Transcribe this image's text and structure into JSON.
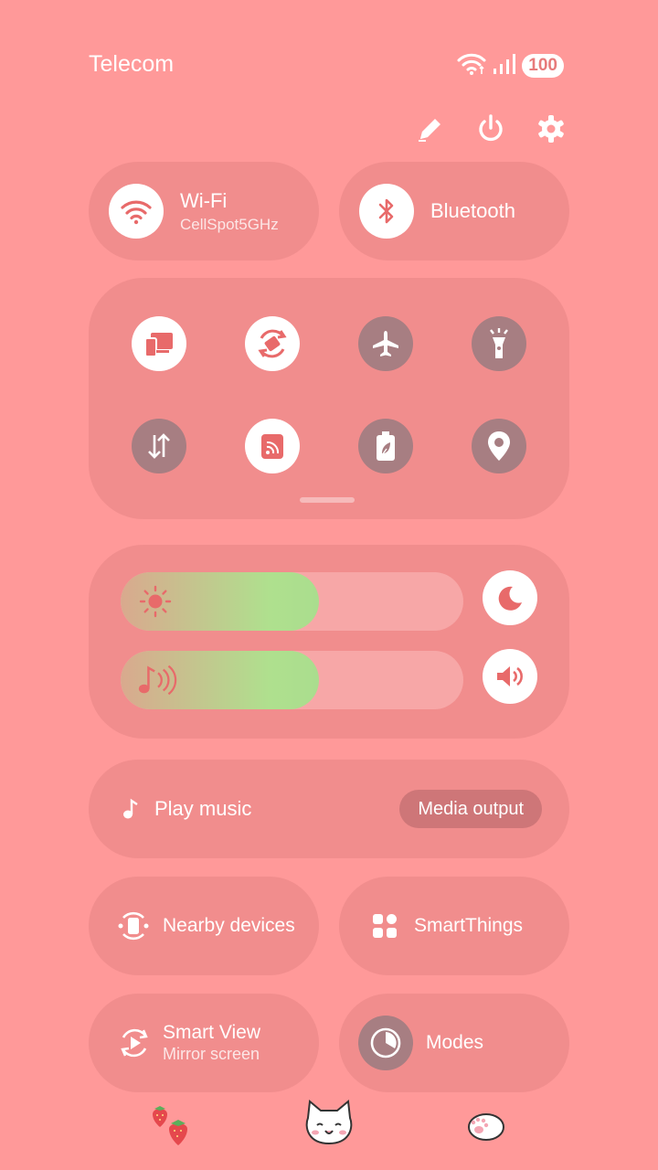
{
  "status": {
    "carrier": "Telecom",
    "battery": "100",
    "wifi_icon": "wifi-status-icon",
    "signal_icon": "signal-icon"
  },
  "toolbar": {
    "edit_icon": "pencil-icon",
    "power_icon": "power-icon",
    "settings_icon": "gear-icon"
  },
  "tiles": {
    "wifi": {
      "label": "Wi-Fi",
      "sub": "CellSpot5GHz",
      "state": "on"
    },
    "bluetooth": {
      "label": "Bluetooth",
      "state": "on"
    }
  },
  "quick_buttons": [
    {
      "icon": "device-transfer-icon",
      "state": "on"
    },
    {
      "icon": "auto-rotate-icon",
      "state": "on"
    },
    {
      "icon": "airplane-icon",
      "state": "off"
    },
    {
      "icon": "flashlight-icon",
      "state": "off"
    },
    {
      "icon": "mobile-data-icon",
      "state": "off"
    },
    {
      "icon": "cast-icon",
      "state": "on"
    },
    {
      "icon": "power-saving-icon",
      "state": "off"
    },
    {
      "icon": "location-icon",
      "state": "off"
    }
  ],
  "sliders": {
    "brightness": {
      "level": 0.58,
      "icon": "sun-icon",
      "side_icon": "moon-icon"
    },
    "volume": {
      "level": 0.58,
      "icon": "music-volume-icon",
      "side_icon": "speaker-icon"
    }
  },
  "media": {
    "label": "Play music",
    "button": "Media output"
  },
  "shortcuts": {
    "nearby": "Nearby devices",
    "smartthings": "SmartThings",
    "smartview": "Smart View",
    "smartview_sub": "Mirror screen",
    "modes": "Modes"
  },
  "colors": {
    "background": "#FF9999",
    "accent": "#E86A6A",
    "inactive": "#A77E82",
    "slider_fill": "#AADD8E"
  }
}
